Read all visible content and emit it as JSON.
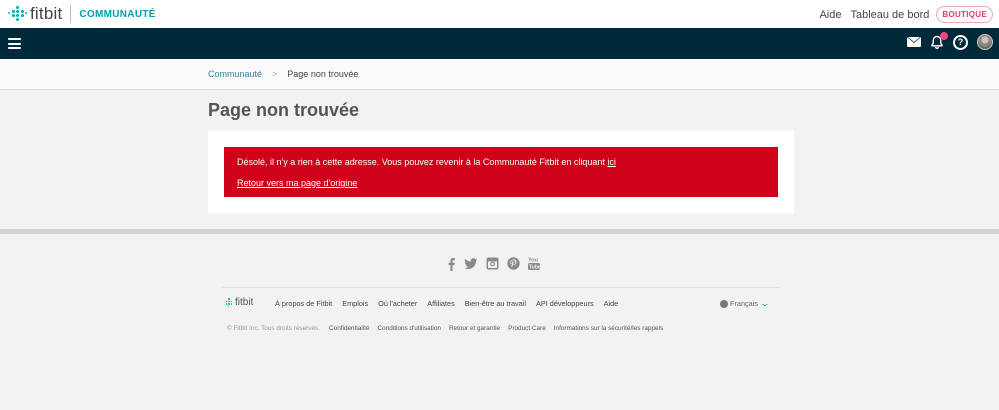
{
  "header": {
    "brand": "fitbit",
    "community_label": "COMMUNAUTÉ",
    "links": [
      "Aide",
      "Tableau de bord"
    ],
    "shop_button": "BOUTIQUE"
  },
  "navbar": {
    "icons": [
      "menu-icon",
      "mail-icon",
      "bell-icon",
      "help-icon",
      "avatar"
    ],
    "help_glyph": "?"
  },
  "breadcrumb": {
    "home": "Communauté",
    "separator": ">",
    "current": "Page non trouvée"
  },
  "main": {
    "title": "Page non trouvée",
    "alert_text": "Désolé, il n'y a rien à cette adresse. Vous pouvez revenir à la Communauté Fitbit en cliquant",
    "alert_link": "ici",
    "back_link": "Retour vers ma page d'origine"
  },
  "footer": {
    "social": [
      "facebook-icon",
      "twitter-icon",
      "instagram-icon",
      "pinterest-icon",
      "youtube-icon"
    ],
    "brand": "fitbit",
    "links": [
      "À propos de Fitbit",
      "Emplois",
      "Où l'acheter",
      "Affiliates",
      "Bien-être au travail",
      "API développeurs",
      "Aide"
    ],
    "language": "Français",
    "copyright": "© Fitbit Inc. Tous droits réservés.",
    "legal": [
      "Confidentialité",
      "Conditions d'utilisation",
      "Retour et garantie",
      "Product Care",
      "Informations sur la sécurité/les rappels"
    ]
  },
  "colors": {
    "navbar": "#002a3a",
    "alert": "#d0021b",
    "teal": "#00b0b9",
    "shop": "#e63a63"
  }
}
